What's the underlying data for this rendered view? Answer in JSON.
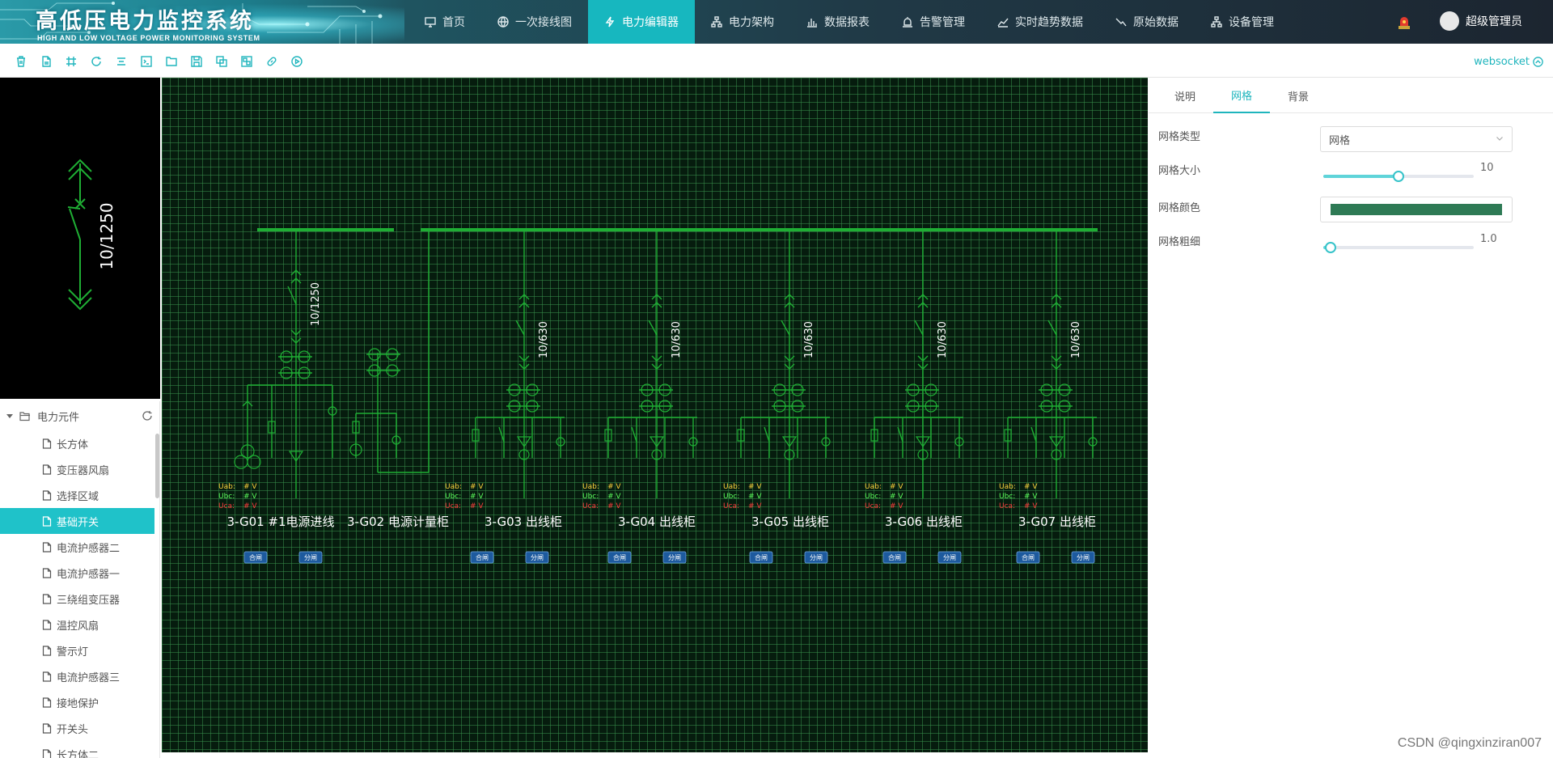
{
  "app": {
    "title": "高低压电力监控系统",
    "subtitle": "HIGH AND LOW VOLTAGE POWER MONITORING SYSTEM",
    "user": "超级管理员",
    "watermark": "CSDN @qingxinziran007"
  },
  "nav": [
    {
      "label": "首页",
      "icon": "monitor-icon"
    },
    {
      "label": "一次接线图",
      "icon": "globe-icon"
    },
    {
      "label": "电力编辑器",
      "icon": "lightning-icon",
      "active": true
    },
    {
      "label": "电力架构",
      "icon": "hierarchy-icon"
    },
    {
      "label": "数据报表",
      "icon": "bar-chart-icon"
    },
    {
      "label": "告警管理",
      "icon": "alarm-icon"
    },
    {
      "label": "实时趋势数据",
      "icon": "trend-icon"
    },
    {
      "label": "原始数据",
      "icon": "raw-data-icon"
    },
    {
      "label": "设备管理",
      "icon": "device-icon"
    }
  ],
  "toolbar": {
    "tools": [
      "delete-icon",
      "new-file-icon",
      "grid-icon",
      "refresh-icon",
      "align-icon",
      "terminal-icon",
      "folder-icon",
      "save-icon",
      "copy-icon",
      "group-icon",
      "link-icon",
      "play-icon"
    ],
    "websocket_label": "websocket"
  },
  "preview": {
    "rating": "10/1250"
  },
  "tree": {
    "root_label": "电力元件",
    "items": [
      "长方体",
      "变压器风扇",
      "选择区域",
      "基础开关",
      "电流护感器二",
      "电流护感器一",
      "三绕组变压器",
      "温控风扇",
      "警示灯",
      "电流护感器三",
      "接地保护",
      "开关头",
      "长方体二"
    ],
    "active_index": 3
  },
  "diagram": {
    "colors": {
      "line": "#1fae34",
      "uab": "#ffd23c",
      "ubc": "#5cff5c",
      "uca": "#ff3c3c",
      "button": "#1d5a9e"
    },
    "voltage_labels": [
      "Uab:",
      "Ubc:",
      "Uca:"
    ],
    "voltage_value": "# V",
    "close_button": "合闸",
    "open_button": "分闸",
    "cabinets": [
      {
        "name": "3-G01 #1电源进线",
        "rating": "10/1250",
        "kind": "incoming"
      },
      {
        "name": "3-G02 电源计量柜",
        "rating": "",
        "kind": "metering"
      },
      {
        "name": "3-G03 出线柜",
        "rating": "10/630",
        "kind": "outgoing"
      },
      {
        "name": "3-G04 出线柜",
        "rating": "10/630",
        "kind": "outgoing"
      },
      {
        "name": "3-G05 出线柜",
        "rating": "10/630",
        "kind": "outgoing"
      },
      {
        "name": "3-G06 出线柜",
        "rating": "10/630",
        "kind": "outgoing"
      },
      {
        "name": "3-G07 出线柜",
        "rating": "10/630",
        "kind": "outgoing"
      }
    ]
  },
  "panel": {
    "tabs": [
      "说明",
      "网格",
      "背景"
    ],
    "active_tab": 1,
    "grid_type_label": "网格类型",
    "grid_type_value": "网格",
    "grid_size_label": "网格大小",
    "grid_size_value": "10",
    "grid_size_fraction": 0.5,
    "grid_color_label": "网格颜色",
    "grid_color_value": "#2e7a55",
    "grid_thickness_label": "网格粗细",
    "grid_thickness_value": "1.0",
    "grid_thickness_fraction": 0.05
  }
}
